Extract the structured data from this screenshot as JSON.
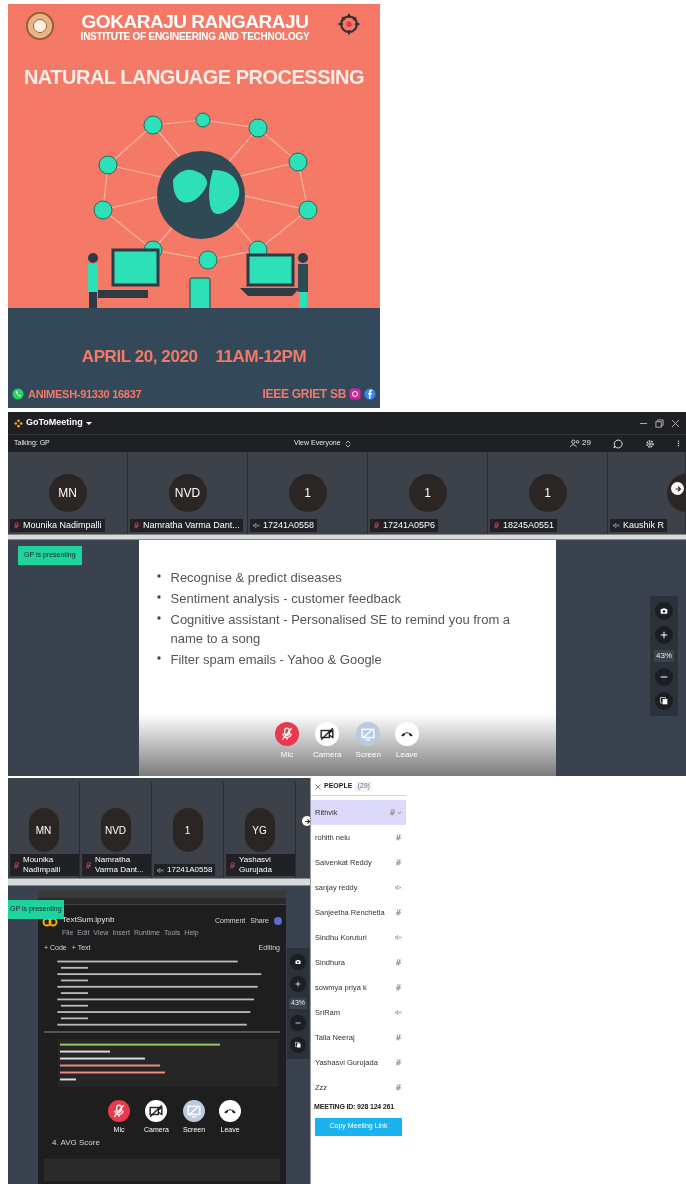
{
  "poster": {
    "institute": "GOKARAJU RANGARAJU",
    "institute_sub": "INSTITUTE OF ENGINEERING AND TECHNOLOGY",
    "heading": "NATURAL LANGUAGE PROCESSING",
    "date": "APRIL 20, 2020",
    "time": "11AM-12PM",
    "contact": "ANIMESH-91330 16837",
    "organizer": "IEEE GRIET SB"
  },
  "meeting_window": {
    "app_name": "GoToMeeting",
    "talking": "Talking: GP",
    "view_mode": "View Everyone",
    "people_count": "29",
    "tiles": [
      {
        "initials": "MN",
        "name": "Mounika Nadimpalli",
        "kind": "mic_muted"
      },
      {
        "initials": "NVD",
        "name": "Namratha Varma Dant...",
        "kind": "mic_muted"
      },
      {
        "initials": "1",
        "name": "17241A0558",
        "kind": "speaker_muted"
      },
      {
        "initials": "1",
        "name": "17241A05P6",
        "kind": "mic_muted"
      },
      {
        "initials": "1",
        "name": "18245A0551",
        "kind": "mic_muted"
      },
      {
        "name": "Kaushik R",
        "kind": "speaker_muted"
      }
    ],
    "presenter_badge": "GP is presenting",
    "slide_bullets": [
      "Recognise & predict diseases",
      "Sentiment analysis - customer feedback",
      "Cognitive assistant - Personalised SE to remind you from a name to a song",
      "Filter spam emails - Yahoo & Google"
    ],
    "zoom_level": "43%",
    "call_controls": [
      {
        "kind": "mic",
        "label": "Mic"
      },
      {
        "kind": "camera",
        "label": "Camera"
      },
      {
        "kind": "screen",
        "label": "Screen"
      },
      {
        "kind": "leave",
        "label": "Leave"
      }
    ]
  },
  "second_window": {
    "tiles": [
      {
        "initials": "MN",
        "name": "Mounika Nadimpalli",
        "kind": "mic_muted"
      },
      {
        "initials": "NVD",
        "name": "Namratha Varma Dant...",
        "kind": "mic_muted"
      },
      {
        "initials": "1",
        "name": "17241A0558",
        "kind": "speaker_muted"
      },
      {
        "initials": "YG",
        "name": "Yashasvi Gurujada",
        "kind": "mic_muted"
      }
    ],
    "presenter_badge": "GP is presenting",
    "notebook": {
      "title": "TextSum.ipynb",
      "menu": [
        "File",
        "Edit",
        "View",
        "Insert",
        "Runtime",
        "Tools",
        "Help"
      ],
      "comment": "Comment",
      "share": "Share",
      "add_code": "+ Code",
      "add_text": "+ Text",
      "mode": "Editing",
      "section": "4. AVG Score"
    },
    "zoom_level": "43%",
    "call_controls": [
      {
        "kind": "mic",
        "label": "Mic"
      },
      {
        "kind": "camera",
        "label": "Camera"
      },
      {
        "kind": "screen",
        "label": "Screen"
      },
      {
        "kind": "leave",
        "label": "Leave"
      }
    ],
    "people_panel": {
      "title": "PEOPLE",
      "count": "(29)",
      "people": [
        {
          "name": "Rithvik",
          "kind": "mic_muted",
          "selected": true
        },
        {
          "name": "rohith nelu",
          "kind": "mic_muted",
          "selected": false
        },
        {
          "name": "Saivenkat Reddy",
          "kind": "mic_muted",
          "selected": false
        },
        {
          "name": "sanjay reddy",
          "kind": "speaker_muted",
          "selected": false
        },
        {
          "name": "Sanjeetha Renchetla",
          "kind": "mic_muted",
          "selected": false
        },
        {
          "name": "Sindhu Koruturi",
          "kind": "speaker_muted",
          "selected": false
        },
        {
          "name": "Sindhura",
          "kind": "mic_muted",
          "selected": false
        },
        {
          "name": "sowmya priya k",
          "kind": "mic_muted",
          "selected": false
        },
        {
          "name": "SriRam",
          "kind": "speaker_muted",
          "selected": false
        },
        {
          "name": "Talla Neeraj",
          "kind": "mic_muted",
          "selected": false
        },
        {
          "name": "Yashasvi Gurujada",
          "kind": "mic_muted",
          "selected": false
        },
        {
          "name": "Zzz",
          "kind": "mic_muted",
          "selected": false
        }
      ],
      "meeting_id": "MEETING ID: 928 124 261",
      "copy_link": "Copy Meeting Link"
    }
  }
}
